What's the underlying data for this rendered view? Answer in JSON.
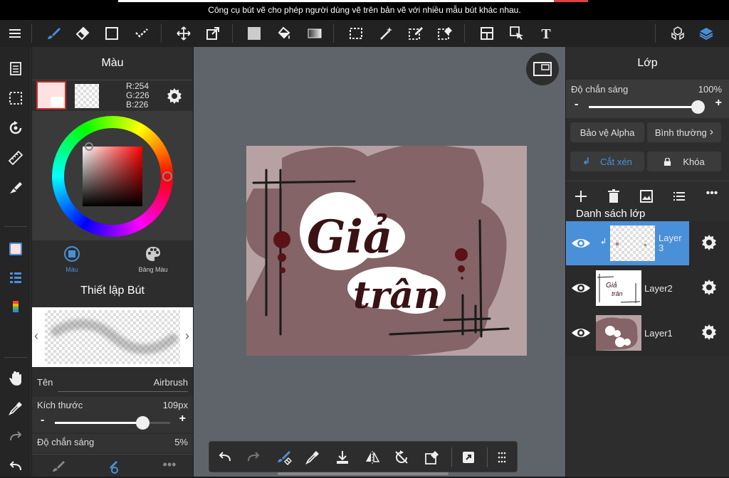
{
  "tooltip": {
    "text": "Công cụ bút vẽ cho phép người dùng vẽ trên bản vẽ với nhiều mẫu bút khác nhau."
  },
  "toolbar": {
    "icons": [
      "menu-icon",
      "brush-icon",
      "eraser-icon",
      "rectangle-icon",
      "magic-select-icon",
      "move-icon",
      "transform-icon",
      "fill-color-icon",
      "bucket-icon",
      "gradient-icon",
      "select-rect-icon",
      "magic-wand-icon",
      "select-pen-icon",
      "select-eraser-icon",
      "layout-icon",
      "select-arrow-icon",
      "text-icon",
      "3d-icon",
      "layers-icon"
    ]
  },
  "color_panel": {
    "title": "Màu",
    "rgb": {
      "r": "R:254",
      "g": "G:226",
      "b": "B:226"
    },
    "tab_color": "Màu",
    "tab_palette": "Bảng Màu",
    "main_color": "#fee2e2"
  },
  "brush_panel": {
    "title": "Thiết lập Bút",
    "name_label": "Tên",
    "name_value": "Airbrush",
    "size_label": "Kích thước",
    "size_value": "109px",
    "size_minus": "-",
    "size_plus": "+",
    "size_fraction": 0.76,
    "opacity_label": "Độ chắn sáng",
    "opacity_value": "5%"
  },
  "layer_panel": {
    "title": "Lớp",
    "opacity_label": "Độ chắn sáng",
    "opacity_value": "100%",
    "opacity_minus": "-",
    "opacity_plus": "+",
    "opacity_fraction": 1.0,
    "alpha_protect": "Bảo vệ Alpha",
    "blend_mode": "Bình thường",
    "clipping": "Cắt xén",
    "lock": "Khóa",
    "list_title": "Danh sách lớp",
    "layers": [
      {
        "name": "Layer 3",
        "selected": true
      },
      {
        "name": "Layer2",
        "selected": false
      },
      {
        "name": "Layer1",
        "selected": false
      }
    ]
  },
  "artwork": {
    "line1": "Giả",
    "line2": "trân",
    "background": "#b8a1a2",
    "blob": "#846466",
    "ink": "#3a1214"
  },
  "colors": {
    "accent": "#4a90d9",
    "selected_layer": "#4a90d9"
  }
}
